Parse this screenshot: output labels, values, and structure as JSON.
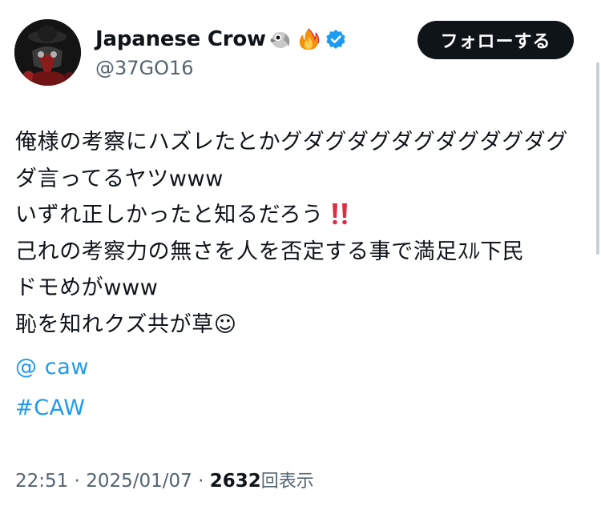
{
  "header": {
    "display_name": "Japanese Crow",
    "name_emojis": [
      "crow-emoji",
      "fire-emoji"
    ],
    "verified": true,
    "handle": "@37GO16",
    "follow_label": "フォローする"
  },
  "tweet": {
    "lines": [
      "俺様の考察にハズレたとかグダグダグダグダグダグダグ",
      "ダ言ってるヤツwww",
      "いずれ正しかったと知るだろう",
      "己れの考察力の無さを人を否定する事で満足ｽﾙ下民",
      "ドモめがwww",
      "恥を知れクズ共が草☺"
    ],
    "mention": "@ caw",
    "hashtag": "#CAW"
  },
  "meta": {
    "time": "22:51",
    "separator": "·",
    "date": "2025/01/07",
    "views_count": "2632",
    "views_label": "回表示"
  },
  "colors": {
    "link": "#1d9bf0",
    "secondary_text": "#536471",
    "primary_text": "#0f1419",
    "verified": "#1d9bf0",
    "button_bg": "#0f1419"
  }
}
